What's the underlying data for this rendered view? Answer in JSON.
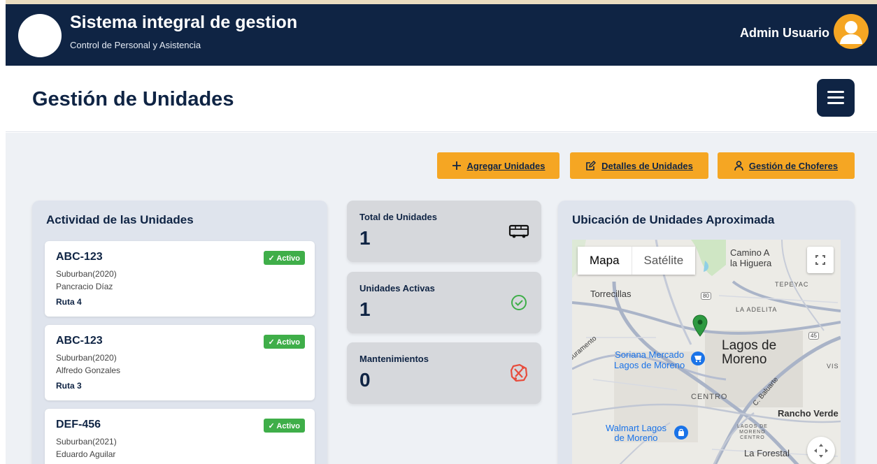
{
  "header": {
    "app_title": "Sistema integral de gestion",
    "app_subtitle": "Control de Personal y Asistencia",
    "user_name": "Admin Usuario"
  },
  "page": {
    "title": "Gestión de Unidades"
  },
  "actions": {
    "add_units": "Agregar Unidades",
    "unit_details": "Detalles de Unidades",
    "driver_management": "Gestión de Choferes"
  },
  "activity": {
    "title": "Actividad de las Unidades",
    "units": [
      {
        "plate": "ABC-123",
        "status": "✓ Activo",
        "model": "Suburban(2020)",
        "driver": "Pancracio Díaz",
        "route": "Ruta 4"
      },
      {
        "plate": "ABC-123",
        "status": "✓ Activo",
        "model": "Suburban(2020)",
        "driver": "Alfredo Gonzales",
        "route": "Ruta 3"
      },
      {
        "plate": "DEF-456",
        "status": "✓ Activo",
        "model": "Suburban(2021)",
        "driver": "Eduardo Aguilar",
        "route": ""
      }
    ]
  },
  "stats": {
    "total": {
      "label": "Total de Unidades",
      "value": "1",
      "icon": "bus-icon"
    },
    "active": {
      "label": "Unidades Activas",
      "value": "1",
      "icon": "check-circle-icon"
    },
    "maintenance": {
      "label": "Mantenimientos",
      "value": "0",
      "icon": "car-crash-icon"
    }
  },
  "map": {
    "title": "Ubicación de Unidades Aproximada",
    "tab_map": "Mapa",
    "tab_satellite": "Satélite",
    "labels": {
      "camino_line1": "Camino A",
      "camino_line2": "la Higuera",
      "torrecillas": "Torrecillas",
      "tepeyac": "TEPEYAC",
      "la_adelita": "LA ADELITA",
      "lagos_line1": "Lagos de",
      "lagos_line2": "Moreno",
      "soriana_line1": "Soriana Mercado",
      "soriana_line2": "Lagos de Moreno",
      "centro": "CENTRO",
      "rancho_verde": "Rancho Verde",
      "walmart_line1": "Walmart Lagos",
      "walmart_line2": "de Moreno",
      "lagos_centro_line1": "LAGOS DE",
      "lagos_centro_line2": "MORENO",
      "lagos_centro_line3": "CENTRO",
      "la_forestal": "La Forestal",
      "baluarte": "C. Baluarte",
      "juramento": "Juramento",
      "route_80": "80",
      "route_45": "45",
      "vis": "VIS"
    }
  },
  "colors": {
    "navy": "#0f2444",
    "accent": "#f5a623",
    "active_green": "#3fae49",
    "danger_red": "#e74c3c"
  }
}
